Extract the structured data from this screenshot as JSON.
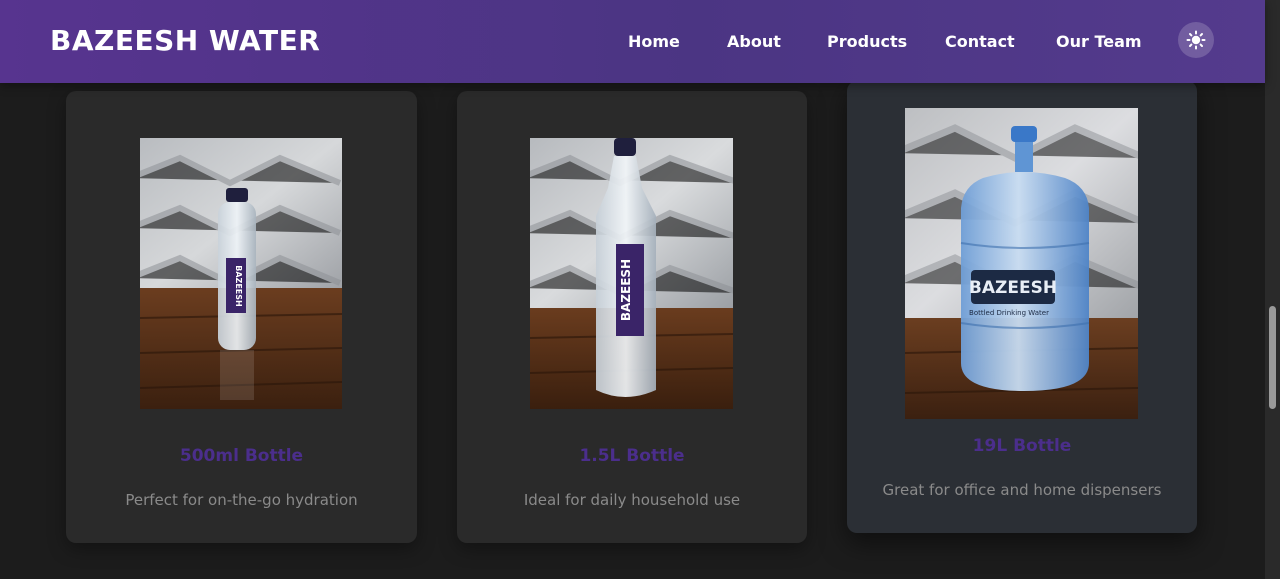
{
  "brand": {
    "name": "BAZEESH WATER"
  },
  "nav": {
    "home": "Home",
    "about": "About",
    "products": "Products",
    "contact": "Contact",
    "team": "Our Team",
    "theme_toggle_icon": "sun-icon"
  },
  "products": [
    {
      "title": "500ml Bottle",
      "description": "Perfect for on-the-go hydration",
      "image": "bottle-500ml-photo",
      "label": "BAZEESH"
    },
    {
      "title": "1.5L Bottle",
      "description": "Ideal for daily household use",
      "image": "bottle-1-5l-photo",
      "label": "BAZEESH"
    },
    {
      "title": "19L Bottle",
      "description": "Great for office and home dispensers",
      "image": "bottle-19l-photo",
      "label": "BAZEESH",
      "sublabel": "Bottled Drinking Water"
    }
  ],
  "colors": {
    "header": "#4f3589",
    "background": "#1c1c1c",
    "card": "#2a2a2a",
    "title": "#4b2e8c",
    "description": "#8a8a8a"
  }
}
